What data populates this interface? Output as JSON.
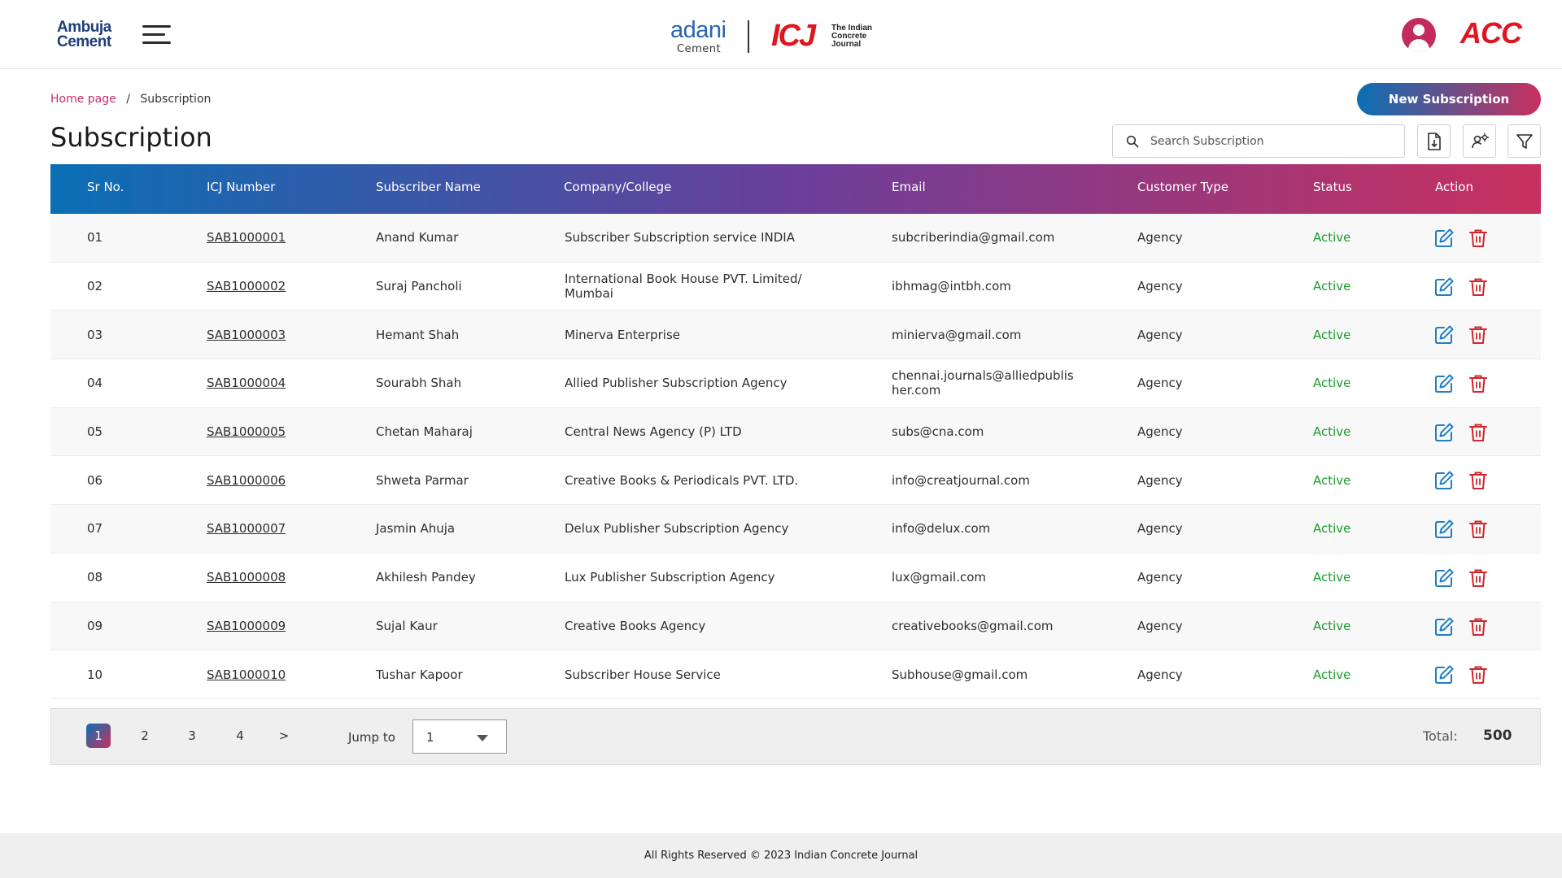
{
  "header": {
    "brand_left_line1": "Ambuja",
    "brand_left_line2": "Cement",
    "brand_center_word": "adani",
    "brand_center_sub": "Cement",
    "brand_icj": "ICJ",
    "brand_icj_tag": [
      "The Indian",
      "Concrete",
      "Journal"
    ],
    "brand_right": "ACC"
  },
  "breadcrumb": {
    "home": "Home page",
    "separator": "/",
    "current": "Subscription"
  },
  "page_title": "Subscription",
  "toolbar": {
    "new_button_label": "New Subscription",
    "search_placeholder": "Search Subscription",
    "search_value": "",
    "icons": [
      "export-file-icon",
      "user-settings-icon",
      "filter-icon"
    ]
  },
  "table": {
    "columns": [
      "Sr No.",
      "ICJ Number",
      "Subscriber Name",
      "Company/College",
      "Email",
      "Customer Type",
      "Status",
      "Action"
    ],
    "rows": [
      {
        "sr": "01",
        "icj": "SAB1000001",
        "name": "Anand Kumar",
        "company": "Subscriber Subscription service INDIA",
        "email": "subcriberindia@gmail.com",
        "type": "Agency",
        "status": "Active"
      },
      {
        "sr": "02",
        "icj": "SAB1000002",
        "name": "Suraj Pancholi",
        "company": "International Book House PVT. Limited/ Mumbai",
        "email": "ibhmag@intbh.com",
        "type": "Agency",
        "status": "Active"
      },
      {
        "sr": "03",
        "icj": "SAB1000003",
        "name": "Hemant Shah",
        "company": "Minerva Enterprise",
        "email": "minierva@gmail.com",
        "type": "Agency",
        "status": "Active"
      },
      {
        "sr": "04",
        "icj": "SAB1000004",
        "name": "Sourabh Shah",
        "company": "Allied Publisher Subscription Agency",
        "email": "chennai.journals@alliedpublisher.com",
        "type": "Agency",
        "status": "Active"
      },
      {
        "sr": "05",
        "icj": "SAB1000005",
        "name": "Chetan Maharaj",
        "company": "Central News Agency (P) LTD",
        "email": "subs@cna.com",
        "type": "Agency",
        "status": "Active"
      },
      {
        "sr": "06",
        "icj": "SAB1000006",
        "name": "Shweta Parmar",
        "company": "Creative Books & Periodicals PVT. LTD.",
        "email": "info@creatjournal.com",
        "type": "Agency",
        "status": "Active"
      },
      {
        "sr": "07",
        "icj": "SAB1000007",
        "name": "Jasmin Ahuja",
        "company": "Delux Publisher Subscription Agency",
        "email": "info@delux.com",
        "type": "Agency",
        "status": "Active"
      },
      {
        "sr": "08",
        "icj": "SAB1000008",
        "name": "Akhilesh Pandey",
        "company": "Lux Publisher Subscription Agency",
        "email": "lux@gmail.com",
        "type": "Agency",
        "status": "Active"
      },
      {
        "sr": "09",
        "icj": "SAB1000009",
        "name": "Sujal Kaur",
        "company": "Creative Books Agency",
        "email": "creativebooks@gmail.com",
        "type": "Agency",
        "status": "Active"
      },
      {
        "sr": "10",
        "icj": "SAB1000010",
        "name": "Tushar Kapoor",
        "company": "Subscriber House Service",
        "email": "Subhouse@gmail.com",
        "type": "Agency",
        "status": "Active"
      }
    ]
  },
  "pagination": {
    "pages": [
      "1",
      "2",
      "3",
      "4"
    ],
    "current_page": "1",
    "next_label": ">",
    "jump_label": "Jump to",
    "jump_value": "1",
    "total_label": "Total:",
    "total_value": "500"
  },
  "footer": {
    "text": "All Rights Reserved © 2023 Indian Concrete Journal"
  },
  "colors": {
    "gradient_start": "#0a6fb5",
    "gradient_mid": "#6b3f9a",
    "gradient_end": "#c8305e",
    "accent_pink": "#c2306a",
    "status_active": "#1a9a2a",
    "edit_icon": "#1f7fc4",
    "delete_icon": "#d0272b",
    "adani_blue": "#2b64b0",
    "adani_purple": "#7a3a98",
    "brand_red": "#e0151f"
  }
}
